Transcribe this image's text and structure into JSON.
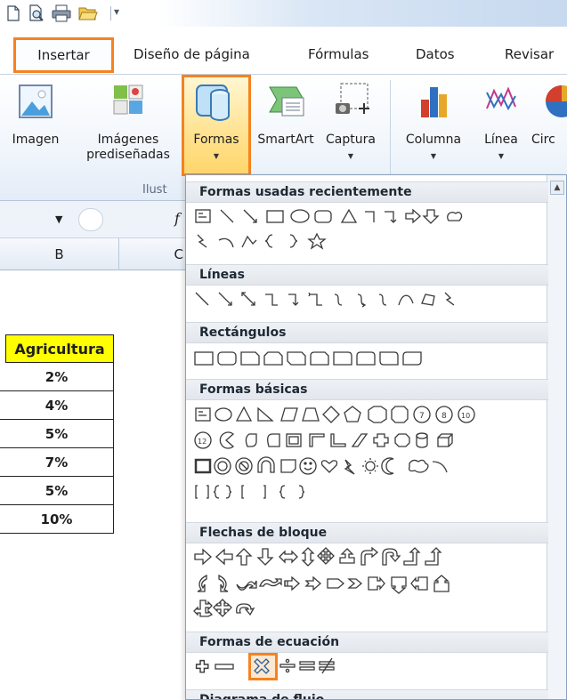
{
  "tabs": [
    "Insertar",
    "Diseño de página",
    "Fórmulas",
    "Datos",
    "Revisar"
  ],
  "ribbon": {
    "imagen": "Imagen",
    "imagenes_1": "Imágenes",
    "imagenes_2": "prediseñadas",
    "formas": "Formas",
    "smartart": "SmartArt",
    "captura": "Captura",
    "columna": "Columna",
    "linea": "Línea",
    "circular": "Circ",
    "group_label": "Ilust"
  },
  "formula_bar": {
    "fx": "f"
  },
  "columns": [
    "B",
    "C"
  ],
  "sheet": {
    "header": "Agricultura",
    "values": [
      "2%",
      "4%",
      "5%",
      "7%",
      "5%",
      "10%"
    ]
  },
  "panel": {
    "categories": {
      "recent": "Formas usadas recientemente",
      "lines": "Líneas",
      "rects": "Rectángulos",
      "basic": "Formas básicas",
      "arrows": "Flechas de bloque",
      "equation": "Formas de ecuación",
      "flow": "Diagrama de flujo"
    }
  },
  "colors": {
    "highlight": "#f58220",
    "agri_fill": "#ffff00"
  }
}
